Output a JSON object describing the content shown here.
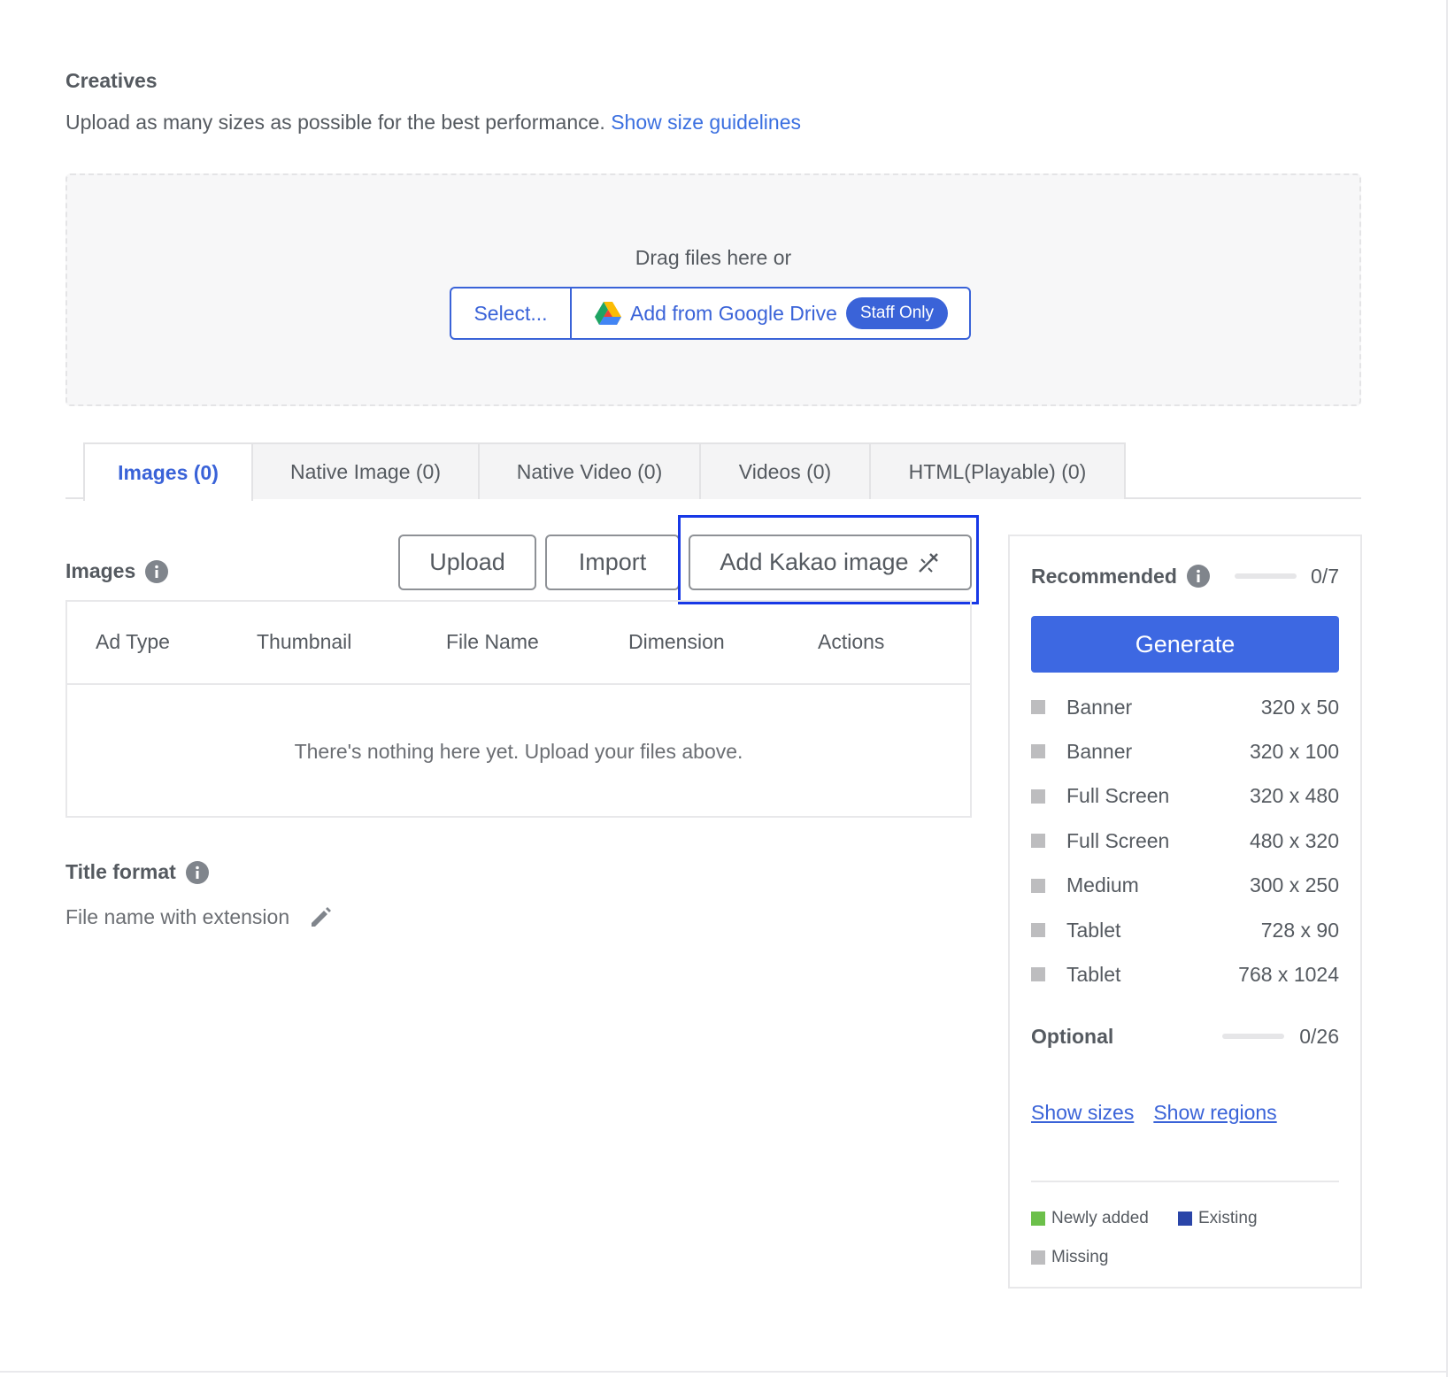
{
  "header": {
    "title": "Creatives",
    "description": "Upload as many sizes as possible for the best performance.",
    "guidelines_link": "Show size guidelines"
  },
  "dropzone": {
    "text": "Drag files here or",
    "select_label": "Select...",
    "drive_label": "Add from Google Drive",
    "staff_badge": "Staff Only"
  },
  "tabs": [
    {
      "label": "Images (0)",
      "active": true
    },
    {
      "label": "Native Image (0)"
    },
    {
      "label": "Native Video (0)"
    },
    {
      "label": "Videos (0)"
    },
    {
      "label": "HTML(Playable) (0)"
    }
  ],
  "images_section": {
    "label": "Images",
    "upload_label": "Upload",
    "import_label": "Import",
    "kakao_label": "Add Kakao image",
    "columns": [
      "Ad Type",
      "Thumbnail",
      "File Name",
      "Dimension",
      "Actions"
    ],
    "empty_message": "There's nothing here yet. Upload your files above."
  },
  "title_format": {
    "label": "Title format",
    "value": "File name with extension"
  },
  "panel": {
    "recommended_label": "Recommended",
    "recommended_count": "0/7",
    "recommended_progress": 0,
    "generate_label": "Generate",
    "sizes": [
      {
        "type": "Banner",
        "dim": "320 x 50"
      },
      {
        "type": "Banner",
        "dim": "320 x 100"
      },
      {
        "type": "Full Screen",
        "dim": "320 x 480"
      },
      {
        "type": "Full Screen",
        "dim": "480 x 320"
      },
      {
        "type": "Medium",
        "dim": "300 x 250"
      },
      {
        "type": "Tablet",
        "dim": "728 x 90"
      },
      {
        "type": "Tablet",
        "dim": "768 x 1024"
      }
    ],
    "optional_label": "Optional",
    "optional_count": "0/26",
    "optional_progress": 0,
    "show_sizes": "Show sizes",
    "show_regions": "Show regions",
    "legend": {
      "newly_added": "Newly added",
      "existing": "Existing",
      "missing": "Missing"
    }
  },
  "colors": {
    "accent": "#3a63d8",
    "newly_added": "#6cc04a",
    "existing": "#2a45a8",
    "missing": "#bdbdbf",
    "highlight": "#1738e6"
  },
  "icons": {
    "info": "info-icon",
    "drive": "google-drive-icon",
    "wand": "magic-wand-icon",
    "pencil": "pencil-icon"
  }
}
